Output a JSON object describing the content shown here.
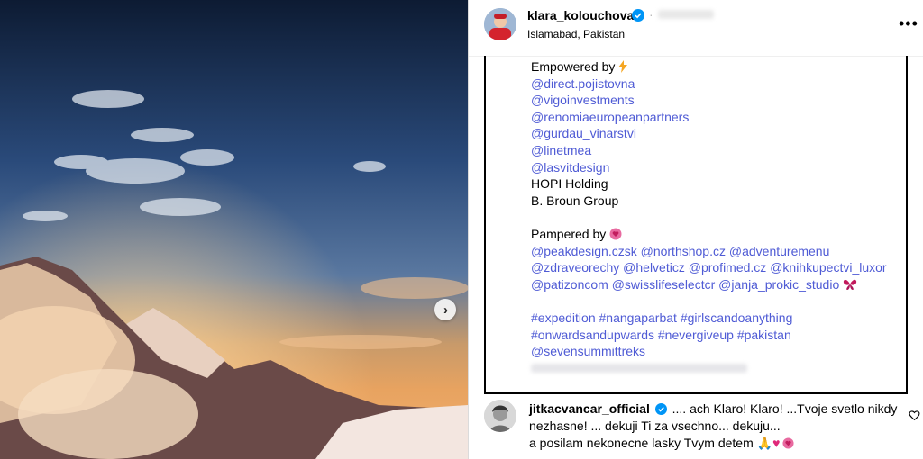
{
  "post": {
    "username": "klara_kolouchova",
    "location": "Islamabad, Pakistan",
    "more_icon": "more-icon",
    "next_icon": "chevron-right-icon"
  },
  "caption": {
    "empowered_heading": "Empowered by",
    "empowered_emoji": "lightning-icon",
    "empowered_links": [
      "@direct.pojistovna",
      "@vigoinvestments",
      "@renomiaeuropeanpartners",
      "@gurdau_vinarstvi",
      "@linetmea",
      "@lasvitdesign"
    ],
    "empowered_plain": [
      "HOPI Holding",
      "B. Broun Group"
    ],
    "pampered_heading": "Pampered by",
    "pampered_emoji": "heart-flower-icon",
    "pampered_lines": [
      [
        "@peakdesign.czsk",
        "@northshop.cz",
        "@adventuremenu"
      ],
      [
        "@zdraveorechy",
        "@helveticz",
        "@profimed.cz",
        "@knihkupectvi_luxor"
      ],
      [
        "@patizoncom",
        "@swisslifeselectcr",
        "@janja_prokic_studio"
      ]
    ],
    "butterfly_emoji": "butterfly-icon",
    "hashtag_lines": [
      [
        "#expedition",
        "#nangaparbat",
        "#girlscandoanything"
      ],
      [
        "#onwardsandupwards",
        "#nevergiveup",
        "#pakistan"
      ],
      [
        "@sevensummittreks"
      ]
    ]
  },
  "comment": {
    "username": "jitkacvancar_official",
    "text_line1": ".... ach Klaro! Klaro! ...Tvoje svetlo nikdy",
    "text_line2": "nezhasne! ... dekuji Ti za vsechno... dekuju...",
    "text_line3": "a posilam nekonecne lasky Tvym detem",
    "like_icon": "heart-outline-icon"
  },
  "colors": {
    "link": "#4f5bd5",
    "verified": "#0095f6"
  }
}
